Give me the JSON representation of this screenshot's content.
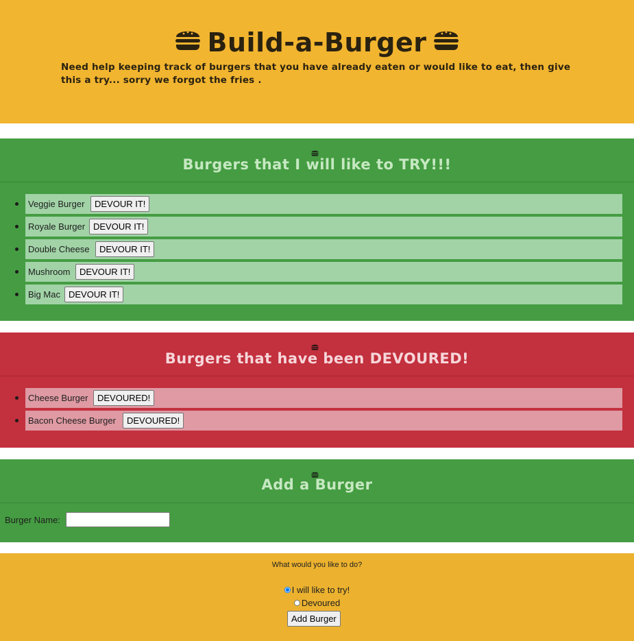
{
  "header": {
    "title": "Build-a-Burger",
    "description": "Need help keeping track of burgers that you have already eaten or would like to eat, then give this a try... sorry we forgot the fries ."
  },
  "try_section": {
    "title": "Burgers that I will like to TRY!!!",
    "items": [
      {
        "name": "Veggie Burger",
        "button": "DEVOUR IT!"
      },
      {
        "name": "Royale Burger",
        "button": "DEVOUR IT!"
      },
      {
        "name": "Double Cheese",
        "button": "DEVOUR IT!"
      },
      {
        "name": "Mushroom",
        "button": "DEVOUR IT!"
      },
      {
        "name": "Big Mac",
        "button": "DEVOUR IT!"
      }
    ]
  },
  "devoured_section": {
    "title": "Burgers that have been DEVOURED!",
    "items": [
      {
        "name": "Cheese Burger",
        "button": "DEVOURED!"
      },
      {
        "name": "Bacon Cheese Burger",
        "button": "DEVOURED!"
      }
    ]
  },
  "add_section": {
    "title": "Add a Burger",
    "field_label": "Burger Name:",
    "field_value": "",
    "question": "What would you like to do?",
    "options": [
      {
        "label": "I will like to try!",
        "checked": true
      },
      {
        "label": "Devoured",
        "checked": false
      }
    ],
    "submit_label": "Add Burger"
  },
  "colors": {
    "header_bg": "#f2b530",
    "try_bg": "#459c42",
    "try_item_bg": "#a1d3a6",
    "devoured_bg": "#c3303e",
    "devoured_item_bg": "#df9aa3",
    "footer_bg": "#ecb22f"
  },
  "icons": [
    "hamburger-icon"
  ]
}
